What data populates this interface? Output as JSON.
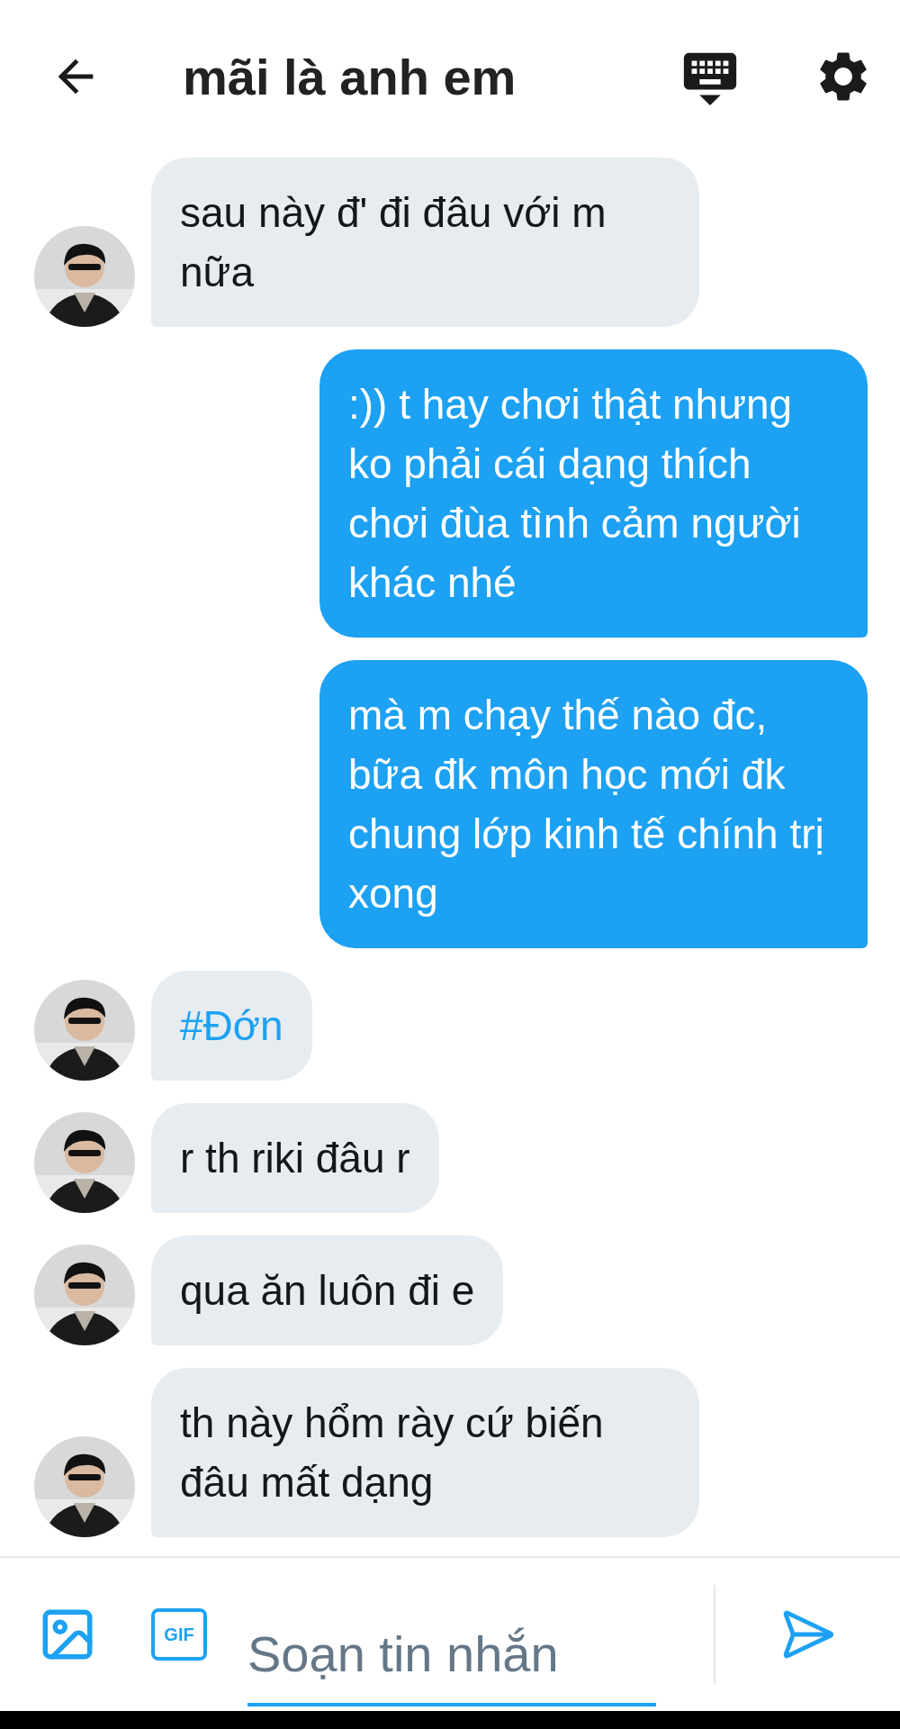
{
  "header": {
    "title": "mãi là anh em"
  },
  "messages": [
    {
      "kind": "incoming",
      "text": "sau này đ' đi đâu với m nữa",
      "link": false
    },
    {
      "kind": "outgoing",
      "text": ":)) t hay chơi thật nhưng ko phải cái dạng thích chơi đùa tình cảm người khác nhé"
    },
    {
      "kind": "outgoing",
      "text": "mà m chạy thế nào đc, bữa đk môn học mới đk chung lớp kinh tế chính trị xong"
    },
    {
      "kind": "incoming",
      "text": "#Đớn",
      "link": true
    },
    {
      "kind": "incoming",
      "text": "r th riki đâu r",
      "link": false
    },
    {
      "kind": "incoming",
      "text": "qua ăn luôn đi e",
      "link": false
    },
    {
      "kind": "incoming",
      "text": "th này hổm rày cứ biến đâu mất dạng",
      "link": false
    }
  ],
  "composer": {
    "gif_label": "GIF",
    "placeholder": "Soạn tin nhắn"
  }
}
